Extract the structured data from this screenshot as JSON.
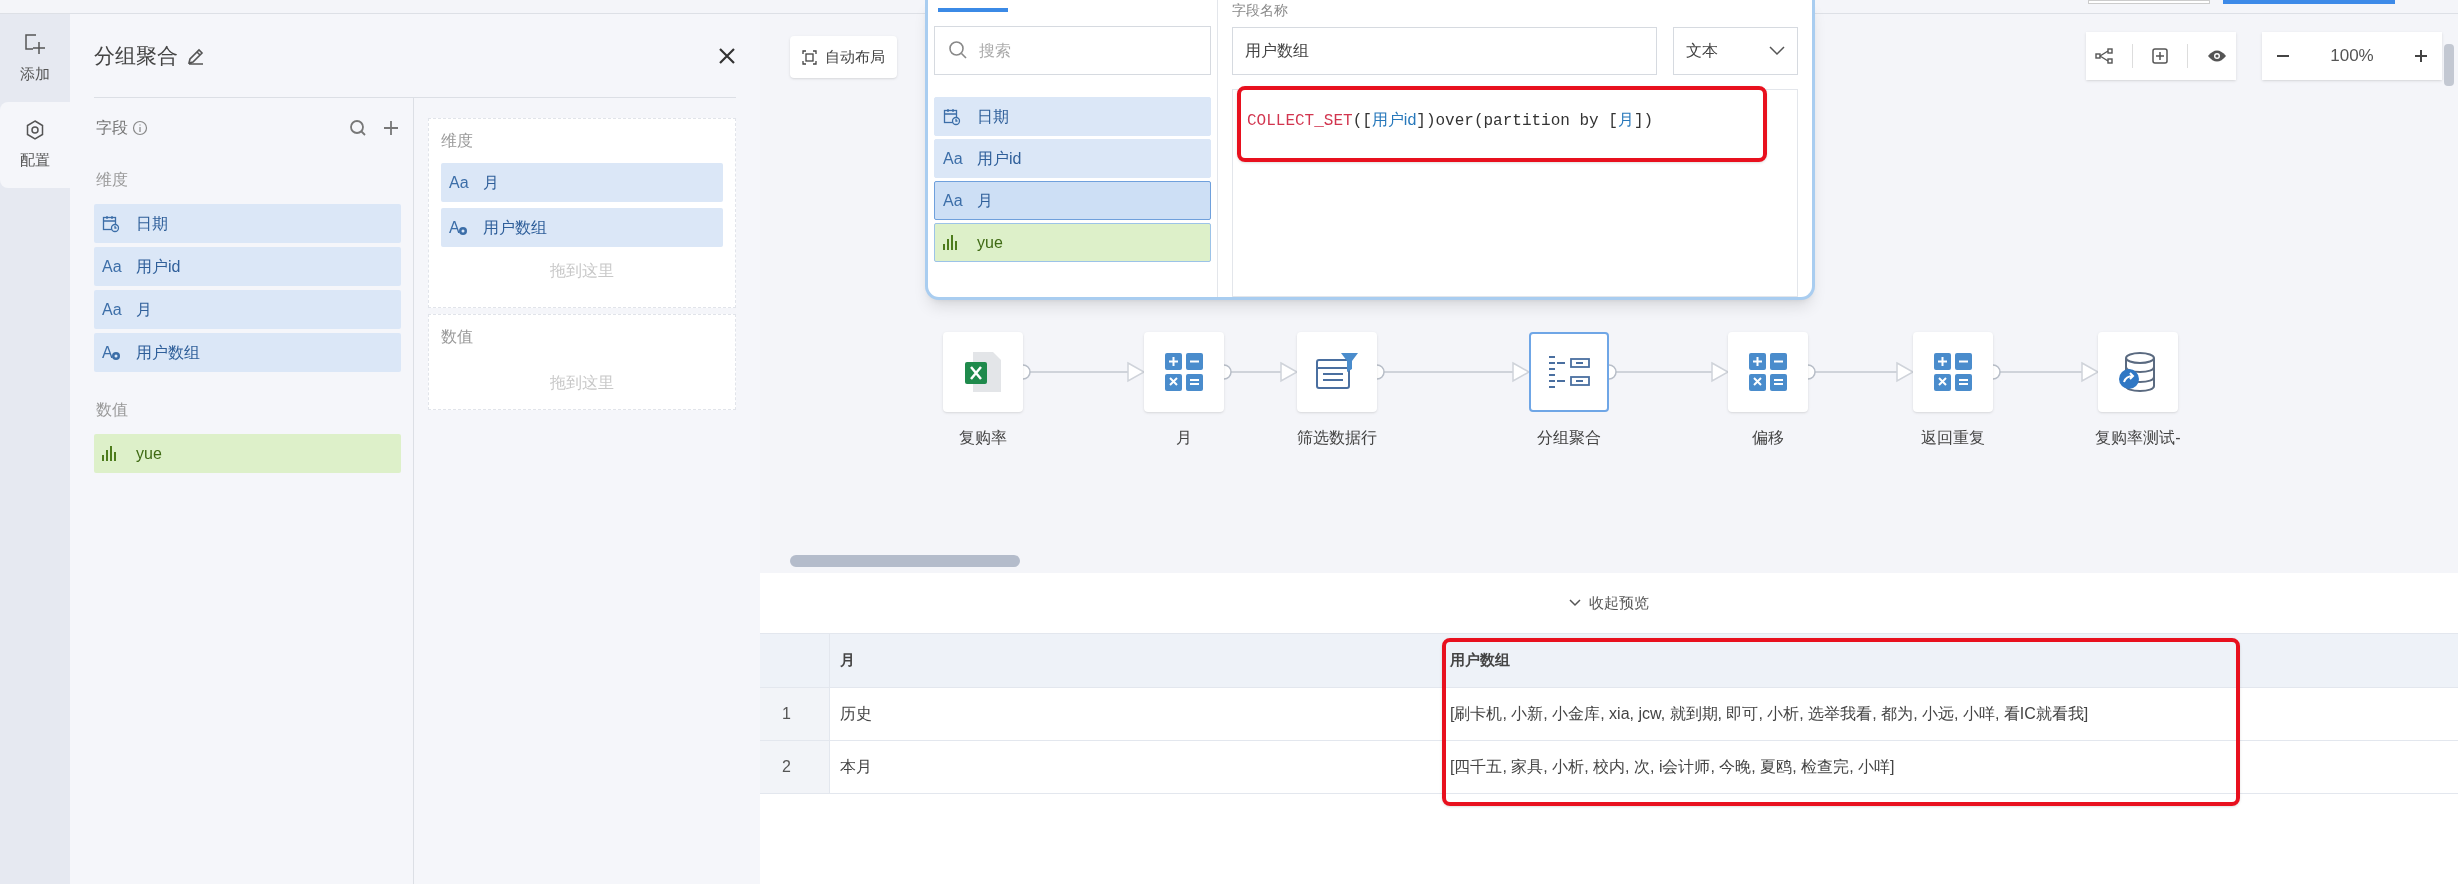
{
  "rail": [
    {
      "kind": "add",
      "label": "添加",
      "selected": false
    },
    {
      "kind": "config",
      "label": "配置",
      "selected": true
    }
  ],
  "panel": {
    "title": "分组聚合",
    "fields_label": "字段",
    "groups": [
      {
        "label": "维度",
        "fields": [
          {
            "kind": "date",
            "name": "日期"
          },
          {
            "kind": "text",
            "glyph": "Aa",
            "name": "用户id"
          },
          {
            "kind": "text",
            "glyph": "Aa",
            "name": "月"
          },
          {
            "kind": "calc",
            "glyph": "A",
            "name": "用户数组"
          }
        ]
      },
      {
        "label": "数值",
        "fields": [
          {
            "kind": "number",
            "name": "yue"
          }
        ]
      }
    ],
    "zones": [
      {
        "label": "维度",
        "items": [
          {
            "kind": "text",
            "glyph": "Aa",
            "name": "月"
          },
          {
            "kind": "calc",
            "glyph": "A",
            "name": "用户数组"
          }
        ],
        "hint": "拖到这里"
      },
      {
        "label": "数值",
        "hint": "拖到这里"
      }
    ]
  },
  "toolbar": {
    "auto_layout": "自动布局",
    "zoom": "100%"
  },
  "popup": {
    "search": {
      "placeholder": "搜索"
    },
    "fields": [
      {
        "kind": "date",
        "name": "日期",
        "selected": false
      },
      {
        "kind": "text",
        "glyph": "Aa",
        "name": "用户id",
        "selected": false
      },
      {
        "kind": "text",
        "glyph": "Aa",
        "name": "月",
        "selected": true
      },
      {
        "kind": "number",
        "name": "yue",
        "selected": false
      }
    ],
    "name_label": "字段名称",
    "name_value": "用户数组",
    "type": "文本",
    "formula": [
      {
        "kind": "func",
        "text": "COLLECT_SET"
      },
      {
        "kind": "plain",
        "text": "(["
      },
      {
        "kind": "field",
        "text": "用户id"
      },
      {
        "kind": "plain",
        "text": "])over(partition by ["
      },
      {
        "kind": "field",
        "text": "月"
      },
      {
        "kind": "plain",
        "text": "])"
      }
    ]
  },
  "flow": [
    {
      "kind": "excel",
      "label": "复购率",
      "selected": false
    },
    {
      "kind": "calc",
      "label": "月",
      "selected": false
    },
    {
      "kind": "filter",
      "label": "筛选数据行",
      "selected": false
    },
    {
      "kind": "group",
      "label": "分组聚合",
      "selected": true
    },
    {
      "kind": "calc",
      "label": "偏移",
      "selected": false
    },
    {
      "kind": "calc",
      "label": "返回重复",
      "selected": false
    },
    {
      "kind": "output",
      "label": "复购率测试-",
      "selected": false
    }
  ],
  "preview": {
    "toggle": "收起预览",
    "columns": [
      "月",
      "用户数组"
    ],
    "rows": [
      {
        "index": "1",
        "cells": [
          "历史",
          "[刷卡机, 小新, 小金库, xia, jcw, 就到期, 即可, 小析, 选举我看, 都为, 小远, 小咩, 看IC就看我]"
        ]
      },
      {
        "index": "2",
        "cells": [
          "本月",
          "[四千五, 家具, 小析, 校内, 次, i会计师, 今晚, 夏鸥, 检查完, 小咩]"
        ]
      }
    ]
  }
}
